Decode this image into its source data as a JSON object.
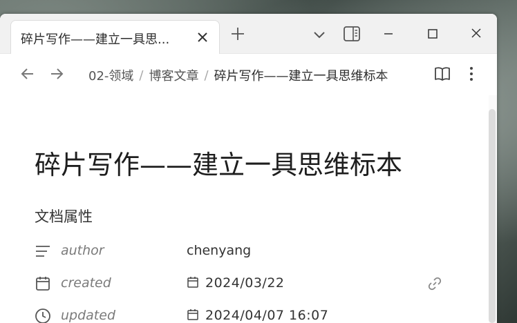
{
  "tab": {
    "title": "碎片写作——建立一具思..."
  },
  "breadcrumb": {
    "items": [
      "02-领域",
      "博客文章",
      "碎片写作——建立一具思维标本"
    ],
    "separator": "/"
  },
  "document": {
    "title": "碎片写作——建立一具思维标本",
    "properties_heading": "文档属性",
    "properties": [
      {
        "key": "author",
        "value": "chenyang",
        "icon": "lines-icon"
      },
      {
        "key": "created",
        "value": "2024/03/22",
        "icon": "calendar-icon"
      },
      {
        "key": "updated",
        "value": "2024/04/07 16:07",
        "icon": "clock-icon"
      }
    ]
  },
  "icons": {
    "tab_close": "close-icon",
    "new_tab": "plus-icon",
    "tab_list": "chevron-down-icon",
    "sidebar": "sidebar-icon",
    "minimize": "minimize-icon",
    "maximize": "maximize-icon",
    "window_close": "close-icon",
    "back": "arrow-left-icon",
    "forward": "arrow-right-icon",
    "reading": "book-icon",
    "more": "more-vertical-icon",
    "link": "link-icon"
  },
  "colors": {
    "accent_text": "#2b2b2b",
    "muted_text": "#7a7a7a",
    "tab_bar": "#f1f1f1"
  }
}
